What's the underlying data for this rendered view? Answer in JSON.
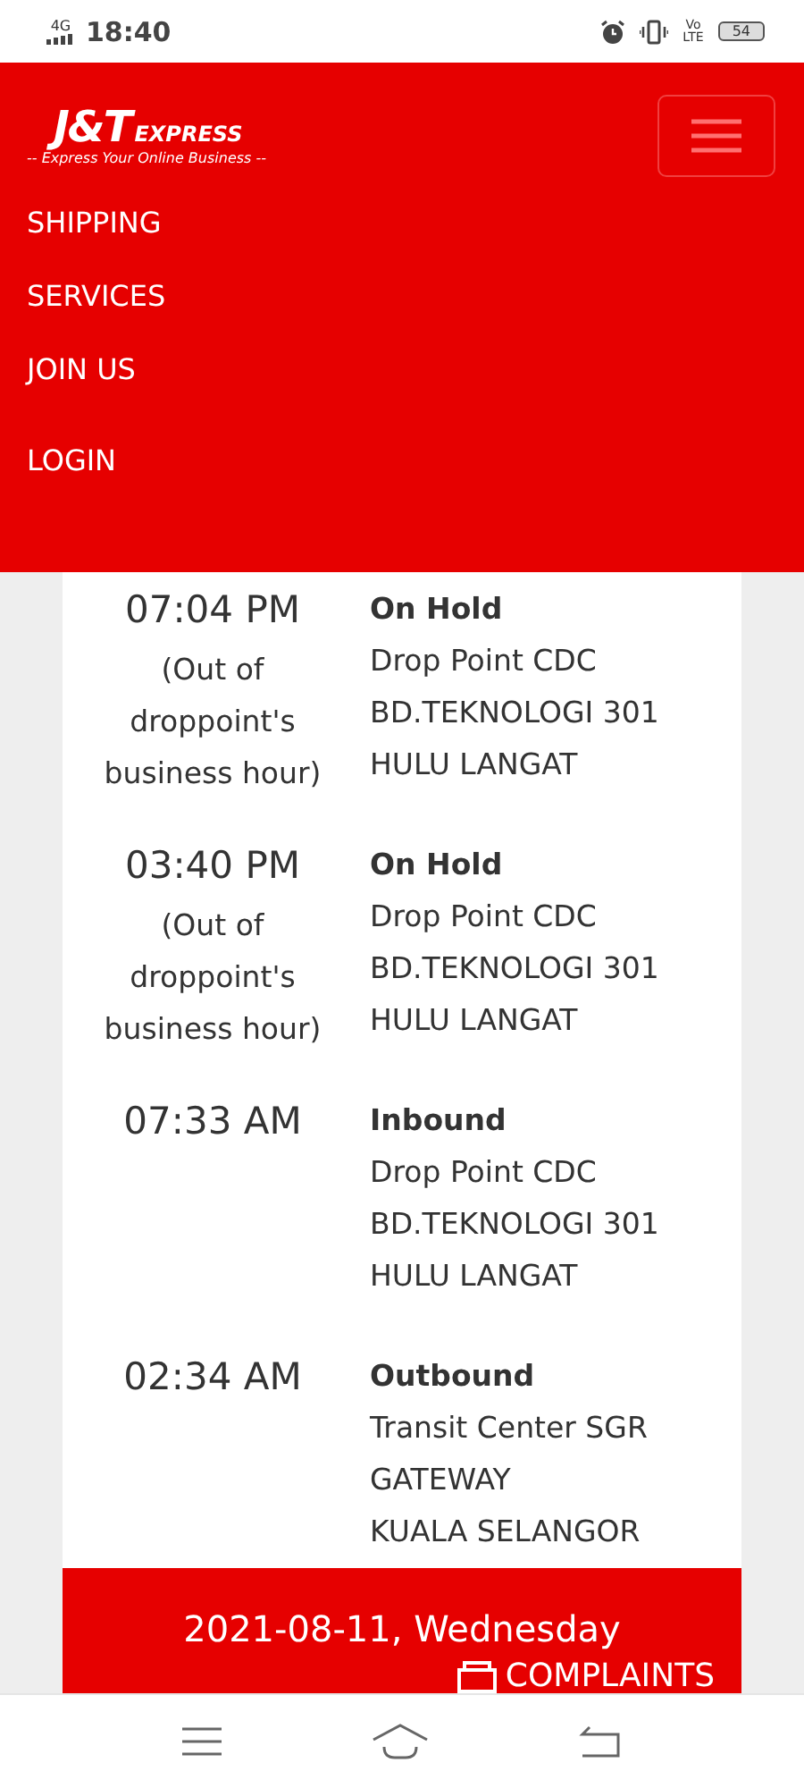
{
  "status_bar": {
    "network": "4G",
    "time": "18:40",
    "volte": [
      "Vo",
      "LTE"
    ],
    "battery": "54"
  },
  "header": {
    "logo": {
      "mark": "J&T",
      "word": "EXPRESS",
      "tagline": "-- Express Your Online Business --"
    },
    "menu": [
      {
        "label": "SHIPPING"
      },
      {
        "label": "SERVICES"
      },
      {
        "label": "JOIN US"
      },
      {
        "label": "LOGIN"
      }
    ]
  },
  "events": [
    {
      "time": "07:04 PM",
      "note": "(Out of droppoint's business hour)",
      "status": "On Hold",
      "location": [
        "Drop Point CDC",
        "BD.TEKNOLOGI 301",
        "HULU LANGAT"
      ]
    },
    {
      "time": "03:40 PM",
      "note": "(Out of droppoint's business hour)",
      "status": "On Hold",
      "location": [
        "Drop Point CDC",
        "BD.TEKNOLOGI 301",
        "HULU LANGAT"
      ]
    },
    {
      "time": "07:33 AM",
      "status": "Inbound",
      "location": [
        "Drop Point CDC",
        "BD.TEKNOLOGI 301",
        "HULU LANGAT"
      ]
    },
    {
      "time": "02:34 AM",
      "status": "Outbound",
      "location": [
        "Transit Center SGR",
        "GATEWAY",
        "KUALA SELANGOR"
      ]
    }
  ],
  "date_banner": "2021-08-11, Wednesday",
  "complaints_button": "COMPLAINTS"
}
